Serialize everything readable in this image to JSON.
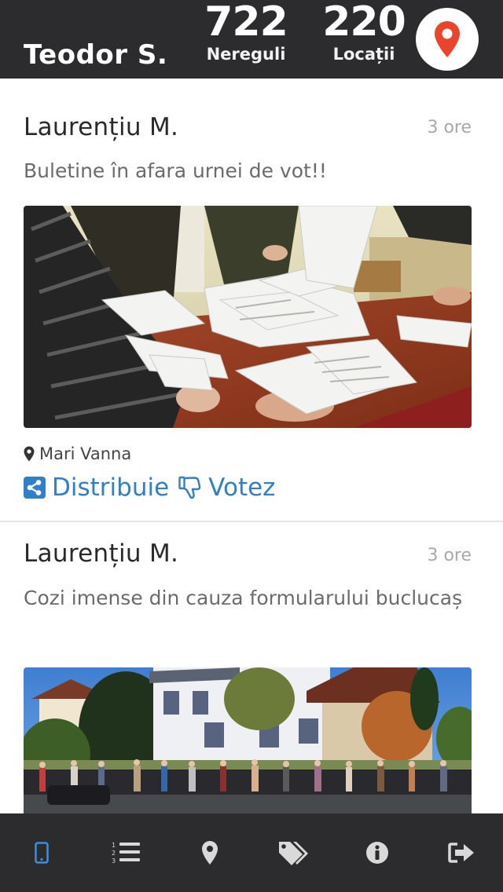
{
  "header": {
    "username": "Teodor S.",
    "stats": [
      {
        "value": "722",
        "label": "Nereguli"
      },
      {
        "value": "220",
        "label": "Locații"
      }
    ],
    "map_icon": "map-pin-icon",
    "accent_color": "#e8452c"
  },
  "feed": {
    "posts": [
      {
        "author": "Laurențiu M.",
        "time": "3 ore",
        "text": "Buletine în afara urnei de vot!!",
        "photo": "ballot-counting-photo",
        "location": "Mari Vanna",
        "actions": {
          "share": "Distribuie",
          "vote": "Votez"
        }
      },
      {
        "author": "Laurențiu M.",
        "time": "3 ore",
        "text": "Cozi imense din cauza formularului buclucaș",
        "photo": "voter-queue-photo"
      }
    ],
    "link_color": "#2f80c9"
  },
  "nav": {
    "items": [
      "phone-icon",
      "numbered-list-icon",
      "map-marker-icon",
      "tags-icon",
      "info-icon",
      "logout-icon"
    ],
    "active_color": "#3b8fd6",
    "inactive_color": "#d9d9d9"
  }
}
